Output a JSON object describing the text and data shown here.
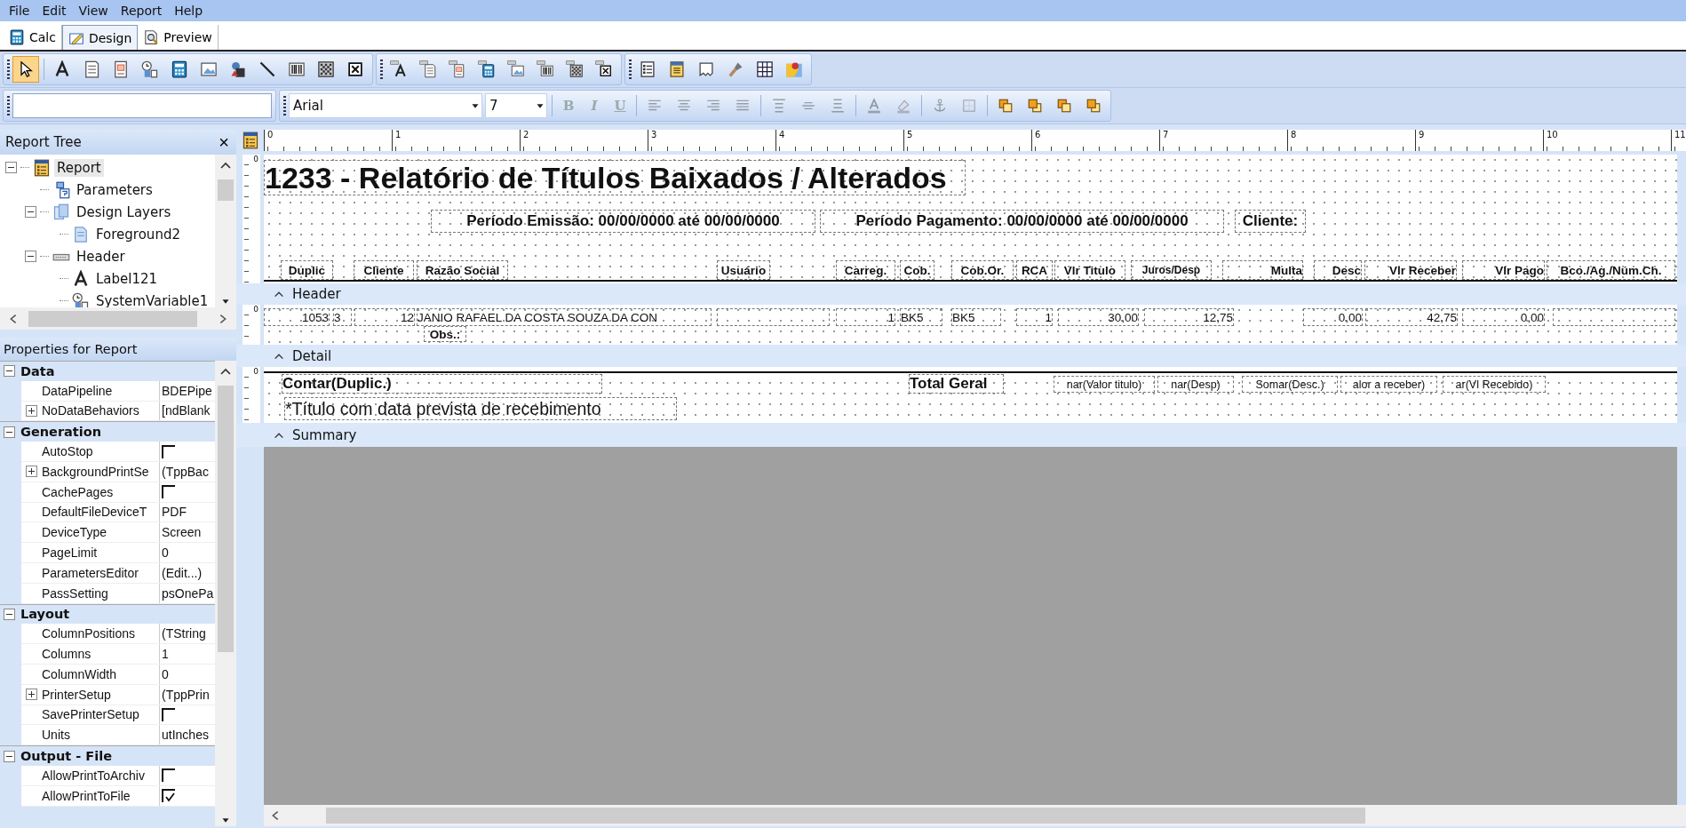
{
  "menu": [
    "File",
    "Edit",
    "View",
    "Report",
    "Help"
  ],
  "tabs": [
    {
      "label": "Calc",
      "kind": "calc",
      "selected": false
    },
    {
      "label": "Design",
      "kind": "design",
      "selected": true
    },
    {
      "label": "Preview",
      "kind": "preview",
      "selected": false
    }
  ],
  "component_toolbar": {
    "groups": [
      [
        {
          "selected": true
        },
        {
          "selected": false
        },
        {
          "selected": false
        },
        {
          "selected": false
        },
        {
          "selected": false
        },
        {
          "selected": false
        },
        {
          "selected": false
        },
        {
          "selected": false
        },
        {
          "selected": false
        },
        {
          "selected": false
        },
        {
          "selected": false
        },
        {
          "selected": false
        }
      ],
      [
        {
          "selected": false
        },
        {
          "selected": false
        },
        {
          "selected": false
        },
        {
          "selected": false
        },
        {
          "selected": false
        },
        {
          "selected": false
        },
        {
          "selected": false
        },
        {
          "selected": false
        }
      ],
      [
        {
          "selected": false
        },
        {
          "selected": false
        },
        {
          "selected": false
        },
        {
          "selected": false
        },
        {
          "selected": false
        },
        {
          "selected": false
        }
      ]
    ]
  },
  "format_toolbar": {
    "font": "Arial",
    "size": "7",
    "style_buttons": [
      "B",
      "I",
      "U"
    ],
    "disabled": true
  },
  "report_tree": {
    "title": "Report Tree",
    "close": "×",
    "items": [
      {
        "label": "Report",
        "kind": "report",
        "selected": true,
        "expanded": true,
        "children": [
          {
            "label": "Parameters",
            "kind": "parameters",
            "selected": false
          },
          {
            "label": "Design Layers",
            "kind": "layers",
            "selected": false,
            "expanded": true,
            "children": [
              {
                "label": "Foreground2",
                "kind": "layer",
                "selected": false
              }
            ]
          },
          {
            "label": "Header",
            "kind": "band",
            "selected": false,
            "expanded": true,
            "children": [
              {
                "label": "Label121",
                "kind": "label",
                "selected": false
              },
              {
                "label": "SystemVariable1",
                "kind": "variable",
                "selected": false
              }
            ]
          }
        ]
      }
    ]
  },
  "properties": {
    "title": "Properties for Report",
    "categories": [
      {
        "name": "Data",
        "expanded": true,
        "rows": [
          {
            "name": "DataPipeline",
            "kind": "text",
            "value": "BDEPipe"
          },
          {
            "name": "NoDataBehaviors",
            "kind": "sub",
            "expanded": false,
            "value": "[ndBlank"
          }
        ]
      },
      {
        "name": "Generation",
        "expanded": true,
        "rows": [
          {
            "name": "AutoStop",
            "kind": "check",
            "checked": false
          },
          {
            "name": "BackgroundPrintSe",
            "kind": "sub",
            "expanded": false,
            "value": "(TppBac"
          },
          {
            "name": "CachePages",
            "kind": "check",
            "checked": false
          },
          {
            "name": "DefaultFileDeviceT",
            "kind": "text",
            "value": "PDF"
          },
          {
            "name": "DeviceType",
            "kind": "text",
            "value": "Screen"
          },
          {
            "name": "PageLimit",
            "kind": "text",
            "value": "0"
          },
          {
            "name": "ParametersEditor",
            "kind": "text",
            "value": "(Edit...)"
          },
          {
            "name": "PassSetting",
            "kind": "text",
            "value": "psOnePa"
          }
        ]
      },
      {
        "name": "Layout",
        "expanded": true,
        "rows": [
          {
            "name": "ColumnPositions",
            "kind": "text",
            "value": "(TString"
          },
          {
            "name": "Columns",
            "kind": "text",
            "value": "1"
          },
          {
            "name": "ColumnWidth",
            "kind": "text",
            "value": "0"
          },
          {
            "name": "PrinterSetup",
            "kind": "sub",
            "expanded": false,
            "value": "(TppPrin"
          },
          {
            "name": "SavePrinterSetup",
            "kind": "check",
            "checked": false
          },
          {
            "name": "Units",
            "kind": "text",
            "value": "utInches"
          }
        ]
      },
      {
        "name": "Output - File",
        "expanded": true,
        "rows": [
          {
            "name": "AllowPrintToArchiv",
            "kind": "check",
            "checked": false
          },
          {
            "name": "AllowPrintToFile",
            "kind": "check",
            "checked": true
          }
        ]
      }
    ]
  },
  "ruler": [
    "0",
    "1",
    "2",
    "3",
    "4",
    "5",
    "6",
    "7",
    "8",
    "9",
    "10",
    "11"
  ],
  "bands": [
    {
      "label": "Header",
      "kind": "header",
      "ruler_mark": "0",
      "items": [
        {
          "text": "1233 - Relatório de Títulos Baixados / Alterados",
          "kind": "title"
        },
        {
          "text": "Período Emissão: 00/00/0000 até 00/00/0000",
          "kind": "param"
        },
        {
          "text": "Período Pagamento: 00/00/0000 até 00/00/0000",
          "kind": "param"
        },
        {
          "text": "Cliente:",
          "kind": "param"
        },
        {
          "text": "Duplic",
          "kind": "column"
        },
        {
          "text": "Cliente",
          "kind": "column"
        },
        {
          "text": "Razão Social",
          "kind": "column"
        },
        {
          "text": "Usuário",
          "kind": "column"
        },
        {
          "text": "Carreg.",
          "kind": "column"
        },
        {
          "text": "Cob.",
          "kind": "column"
        },
        {
          "text": "Cob.Or.",
          "kind": "column"
        },
        {
          "text": "RCA",
          "kind": "column"
        },
        {
          "text": "Vlr Titulo",
          "kind": "column"
        },
        {
          "text": "Juros/Desp",
          "kind": "column_small"
        },
        {
          "text": "Multa",
          "kind": "column_right"
        },
        {
          "text": "Desc",
          "kind": "column_right"
        },
        {
          "text": "Vlr Receber",
          "kind": "column_right"
        },
        {
          "text": "Vlr Pago",
          "kind": "column_right"
        },
        {
          "text": "Bco./Ag./Núm.Ch.",
          "kind": "column"
        }
      ]
    },
    {
      "label": "Detail",
      "kind": "detail",
      "ruler_mark": "0",
      "items": [
        {
          "text": "1053",
          "kind": "number"
        },
        {
          "text": "3",
          "kind": "field"
        },
        {
          "text": "12",
          "kind": "number"
        },
        {
          "text": "JANIO RAFAEL DA COSTA SOUZA DA CON",
          "kind": "field"
        },
        {
          "kind": "empty"
        },
        {
          "text": "1",
          "kind": "number"
        },
        {
          "text": "BK5",
          "kind": "field"
        },
        {
          "text": "BK5",
          "kind": "field"
        },
        {
          "text": "1",
          "kind": "number"
        },
        {
          "text": "30,00",
          "kind": "number"
        },
        {
          "text": "12,75",
          "kind": "number"
        },
        {
          "text": "0,00",
          "kind": "number"
        },
        {
          "text": "42,75",
          "kind": "number"
        },
        {
          "text": "0,00",
          "kind": "number"
        },
        {
          "kind": "empty"
        },
        {
          "text": "Obs.:",
          "kind": "column"
        }
      ]
    },
    {
      "label": "Summary",
      "kind": "summary",
      "ruler_mark": "0",
      "items": [
        {
          "text": "Contar(Duplic.)",
          "kind": "total"
        },
        {
          "text": "Total Geral",
          "kind": "total"
        },
        {
          "text": "nar(Valor titulo)",
          "kind": "calc"
        },
        {
          "text": "nar(Desp)",
          "kind": "calc"
        },
        {
          "text": "Somar(Desc.)",
          "kind": "calc"
        },
        {
          "text": "alor a receber)",
          "kind": "calc"
        },
        {
          "text": "ar(Vl Recebido)",
          "kind": "calc"
        },
        {
          "text": "*Título com data prevista  de recebimento",
          "kind": "note"
        }
      ]
    }
  ]
}
